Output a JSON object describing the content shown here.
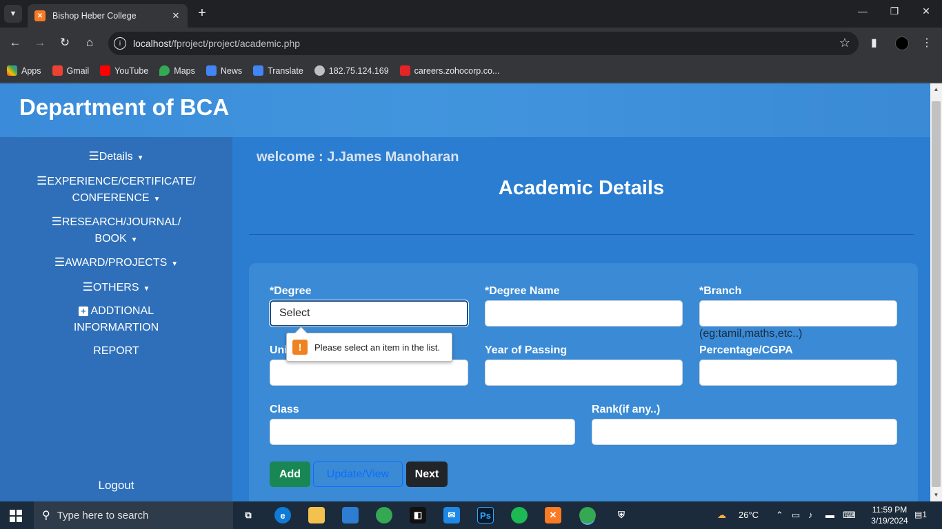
{
  "browser": {
    "tab_title": "Bishop Heber College",
    "url_host": "localhost",
    "url_path": "/fproject/project/academic.php",
    "bookmarks": [
      "Apps",
      "Gmail",
      "YouTube",
      "Maps",
      "News",
      "Translate",
      "182.75.124.169",
      "careers.zohocorp.co..."
    ]
  },
  "header": {
    "title": "Department of BCA"
  },
  "sidebar": {
    "items": [
      {
        "label": "Details"
      },
      {
        "label_line1": "EXPERIENCE/CERTIFICATE/",
        "label_line2": "CONFERENCE"
      },
      {
        "label_line1": "RESEARCH/JOURNAL/",
        "label_line2": "BOOK"
      },
      {
        "label": "AWARD/PROJECTS"
      },
      {
        "label": "OTHERS"
      },
      {
        "label_line1": "ADDTIONAL",
        "label_line2": "INFORMARTION"
      },
      {
        "label": "REPORT"
      }
    ],
    "logout": "Logout"
  },
  "main": {
    "welcome": "welcome : J.James Manoharan",
    "heading": "Academic Details"
  },
  "form": {
    "degree_label": "*Degree",
    "degree_value": "Select",
    "degree_name_label": "*Degree Name",
    "branch_label": "*Branch",
    "branch_hint": "(eg:tamil,maths,etc..)",
    "university_label": "Uni",
    "year_label": "Year of Passing",
    "percentage_label": "Percentage/CGPA",
    "class_label": "Class",
    "rank_label": "Rank(if any..)",
    "tooltip": "Please select an item in the list.",
    "add_button": "Add",
    "update_button": "Update/View",
    "next_button": "Next"
  },
  "taskbar": {
    "search_placeholder": "Type here to search",
    "weather": "26°C",
    "time": "11:59 PM",
    "date": "3/19/2024",
    "notifications": "1"
  },
  "colors": {
    "page_bg": "#2a7dd1",
    "sidebar_bg": "#2f6fb9",
    "card_bg": "#3a8ad6",
    "add_green": "#198754",
    "next_dark": "#212529",
    "update_blue": "#0d6efd"
  }
}
